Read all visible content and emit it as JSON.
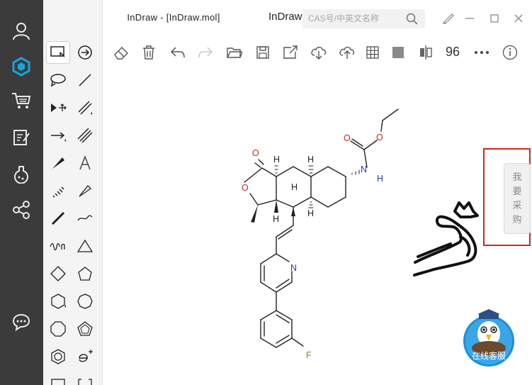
{
  "window": {
    "title": "InDraw - [InDraw.mol]",
    "brand": "InDraw"
  },
  "search": {
    "placeholder": "CAS号/中英文名称"
  },
  "toolbar": {
    "zoom": "96"
  },
  "molecule": {
    "atoms": [
      "O",
      "O",
      "H",
      "H",
      "H",
      "H",
      "H",
      "O",
      "O",
      "N",
      "H",
      "N",
      "F"
    ]
  },
  "side_tab": {
    "chars": [
      "我",
      "要",
      "采",
      "购"
    ]
  },
  "service": {
    "label": "在线客服"
  },
  "colors": {
    "nav_bg": "#3b3b3b",
    "nav_accent": "#1aa3d9",
    "oxygen": "#d9231e",
    "nitrogen": "#2b3aa6",
    "fluorine": "#7a8a20",
    "highlight": "#d9231e"
  },
  "icons": {
    "nav": [
      "user-icon",
      "molecule-logo-icon",
      "cart-icon",
      "edit-document-icon",
      "flask-icon",
      "share-icon",
      "chat-icon"
    ],
    "toolbar": [
      "eraser-icon",
      "trash-icon",
      "undo-icon",
      "redo-icon",
      "open-folder-icon",
      "save-icon",
      "export-icon",
      "cloud-download-icon",
      "cloud-upload-icon",
      "grid-icon",
      "color-square-icon",
      "align-icon",
      "more-icon",
      "info-icon"
    ]
  }
}
